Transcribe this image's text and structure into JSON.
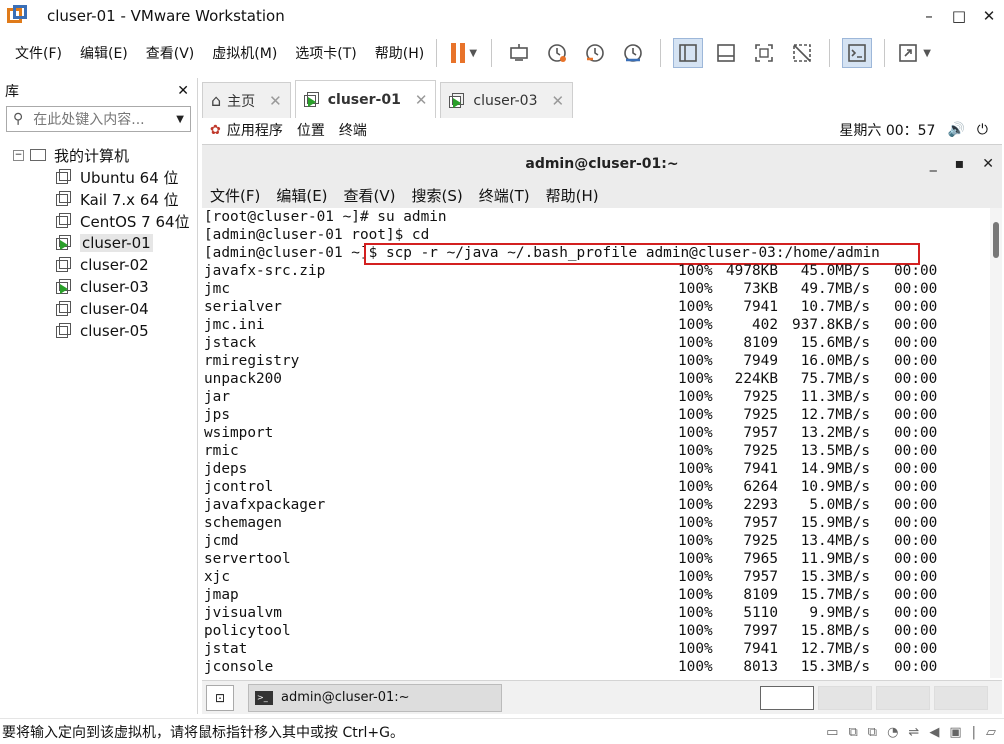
{
  "window": {
    "title": "cluser-01 - VMware Workstation",
    "minimize": "–",
    "maximize": "□",
    "close": "✕"
  },
  "menu": [
    "文件(F)",
    "编辑(E)",
    "查看(V)",
    "虚拟机(M)",
    "选项卡(T)",
    "帮助(H)"
  ],
  "library": {
    "title": "库",
    "close": "✕",
    "search_placeholder": "在此处键入内容...",
    "root": "我的计算机",
    "items": [
      {
        "label": "Ubuntu 64 位",
        "running": false
      },
      {
        "label": "Kail 7.x 64 位",
        "running": false
      },
      {
        "label": "CentOS 7 64位",
        "running": false
      },
      {
        "label": "cluser-01",
        "running": true,
        "selected": true
      },
      {
        "label": "cluser-02",
        "running": false
      },
      {
        "label": "cluser-03",
        "running": true
      },
      {
        "label": "cluser-04",
        "running": false
      },
      {
        "label": "cluser-05",
        "running": false
      }
    ]
  },
  "tabs": [
    {
      "label": "主页",
      "close": "✕"
    },
    {
      "label": "cluser-01",
      "close": "✕",
      "active": true
    },
    {
      "label": "cluser-03",
      "close": "✕"
    }
  ],
  "gnome": {
    "apps": "应用程序",
    "places": "位置",
    "terminal": "终端",
    "clock": "星期六 00：57",
    "volume_icon": "🔊",
    "power_icon": "⏻"
  },
  "terminal": {
    "title": "admin@cluser-01:~",
    "menu": [
      "文件(F)",
      "编辑(E)",
      "查看(V)",
      "搜索(S)",
      "终端(T)",
      "帮助(H)"
    ],
    "lines": [
      "[root@cluser-01 ~]# su admin",
      "[admin@cluser-01 root]$ cd",
      "[admin@cluser-01 ~]$ scp -r ~/java ~/.bash_profile admin@cluser-03:/home/admin"
    ],
    "transfers": [
      {
        "name": "javafx-src.zip",
        "pct": "100%",
        "size": "4978KB",
        "speed": "45.0MB/s",
        "time": "00:00"
      },
      {
        "name": "jmc",
        "pct": "100%",
        "size": "73KB",
        "speed": "49.7MB/s",
        "time": "00:00"
      },
      {
        "name": "serialver",
        "pct": "100%",
        "size": "7941",
        "speed": "10.7MB/s",
        "time": "00:00"
      },
      {
        "name": "jmc.ini",
        "pct": "100%",
        "size": "402",
        "speed": "937.8KB/s",
        "time": "00:00"
      },
      {
        "name": "jstack",
        "pct": "100%",
        "size": "8109",
        "speed": "15.6MB/s",
        "time": "00:00"
      },
      {
        "name": "rmiregistry",
        "pct": "100%",
        "size": "7949",
        "speed": "16.0MB/s",
        "time": "00:00"
      },
      {
        "name": "unpack200",
        "pct": "100%",
        "size": "224KB",
        "speed": "75.7MB/s",
        "time": "00:00"
      },
      {
        "name": "jar",
        "pct": "100%",
        "size": "7925",
        "speed": "11.3MB/s",
        "time": "00:00"
      },
      {
        "name": "jps",
        "pct": "100%",
        "size": "7925",
        "speed": "12.7MB/s",
        "time": "00:00"
      },
      {
        "name": "wsimport",
        "pct": "100%",
        "size": "7957",
        "speed": "13.2MB/s",
        "time": "00:00"
      },
      {
        "name": "rmic",
        "pct": "100%",
        "size": "7925",
        "speed": "13.5MB/s",
        "time": "00:00"
      },
      {
        "name": "jdeps",
        "pct": "100%",
        "size": "7941",
        "speed": "14.9MB/s",
        "time": "00:00"
      },
      {
        "name": "jcontrol",
        "pct": "100%",
        "size": "6264",
        "speed": "10.9MB/s",
        "time": "00:00"
      },
      {
        "name": "javafxpackager",
        "pct": "100%",
        "size": "2293",
        "speed": "5.0MB/s",
        "time": "00:00"
      },
      {
        "name": "schemagen",
        "pct": "100%",
        "size": "7957",
        "speed": "15.9MB/s",
        "time": "00:00"
      },
      {
        "name": "jcmd",
        "pct": "100%",
        "size": "7925",
        "speed": "13.4MB/s",
        "time": "00:00"
      },
      {
        "name": "servertool",
        "pct": "100%",
        "size": "7965",
        "speed": "11.9MB/s",
        "time": "00:00"
      },
      {
        "name": "xjc",
        "pct": "100%",
        "size": "7957",
        "speed": "15.3MB/s",
        "time": "00:00"
      },
      {
        "name": "jmap",
        "pct": "100%",
        "size": "8109",
        "speed": "15.7MB/s",
        "time": "00:00"
      },
      {
        "name": "jvisualvm",
        "pct": "100%",
        "size": "5110",
        "speed": "9.9MB/s",
        "time": "00:00"
      },
      {
        "name": "policytool",
        "pct": "100%",
        "size": "7997",
        "speed": "15.8MB/s",
        "time": "00:00"
      },
      {
        "name": "jstat",
        "pct": "100%",
        "size": "7941",
        "speed": "12.7MB/s",
        "time": "00:00"
      },
      {
        "name": "jconsole",
        "pct": "100%",
        "size": "8013",
        "speed": "15.3MB/s",
        "time": "00:00"
      }
    ]
  },
  "taskbar": {
    "task_label": "admin@cluser-01:~"
  },
  "status": {
    "message": "要将输入定向到该虚拟机，请将鼠标指针移入其中或按 Ctrl+G。"
  },
  "colors": {
    "highlight_border": "#d32020",
    "pause": "#e8732a",
    "running": "#2aa02a"
  }
}
